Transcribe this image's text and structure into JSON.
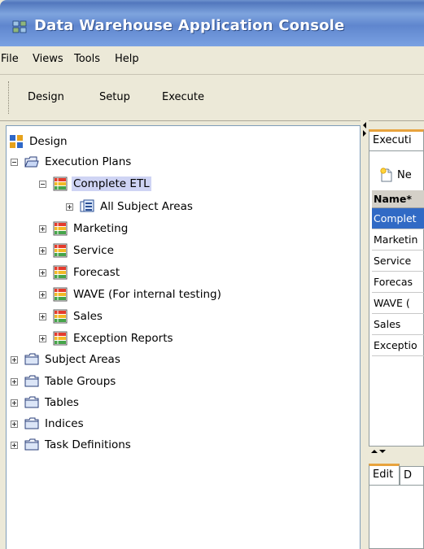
{
  "window": {
    "title": "Data Warehouse Application Console"
  },
  "menu": [
    "File",
    "Views",
    "Tools",
    "Help"
  ],
  "toolbar": {
    "items": [
      "Design",
      "Setup",
      "Execute"
    ]
  },
  "tree": {
    "root": "Design",
    "execution_plans": "Execution Plans",
    "complete_etl": "Complete ETL",
    "all_subject_areas": "All Subject Areas",
    "plans": [
      "Marketing",
      "Service",
      "Forecast",
      "WAVE (For internal testing)",
      "Sales",
      "Exception Reports"
    ],
    "folders": [
      "Subject Areas",
      "Table Groups",
      "Tables",
      "Indices",
      "Task Definitions"
    ]
  },
  "right": {
    "tab_label": "Executi",
    "new_label": "Ne",
    "column_header": "Name*",
    "rows": [
      "Complet",
      "Marketin",
      "Service",
      "Forecas",
      "WAVE (",
      "Sales",
      "Exceptio"
    ],
    "bottom_tabs": [
      "Edit",
      "D"
    ]
  },
  "colors": {
    "selection_highlight": "#cfd4f4",
    "grid_selection": "#316ac5",
    "titlebar": "#5f86ce"
  }
}
